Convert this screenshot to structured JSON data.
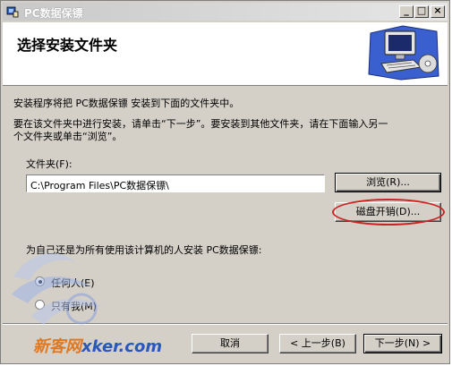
{
  "window": {
    "title": "PC数据保镖",
    "controls": [
      "_",
      "□",
      "×"
    ]
  },
  "header": {
    "title": "选择安装文件夹"
  },
  "body": {
    "intro_line": "安装程序将把 PC数据保镖 安装到下面的文件夹中。",
    "instruction_line1": "要在该文件夹中进行安装，请单击“下一步”。要安装到其他文件夹，请在下面输入另一",
    "instruction_line2": "个文件夹或单击“浏览”。",
    "folder_label": "文件夹(F):",
    "folder_value": "C:\\Program Files\\PC数据保镖\\",
    "browse_label": "浏览(R)...",
    "disk_cost_label": "磁盘开销(D)...",
    "audience_question": "为自己还是为所有使用该计算机的人安装 PC数据保镖:",
    "radio_options": [
      {
        "label": "任何人(E)",
        "selected": true
      },
      {
        "label": "只有我(M)",
        "selected": false
      }
    ]
  },
  "footer": {
    "cancel_label": "取消",
    "back_label": "< 上一步(B)",
    "next_label": "下一步(N) >"
  },
  "watermark": {
    "text_cn": "新客网",
    "text_en": "xker.com"
  },
  "colors": {
    "dialog_bg": "#d4d0c8",
    "highlight_ellipse": "#cc2222",
    "watermark_blue": "#2a58b8"
  }
}
